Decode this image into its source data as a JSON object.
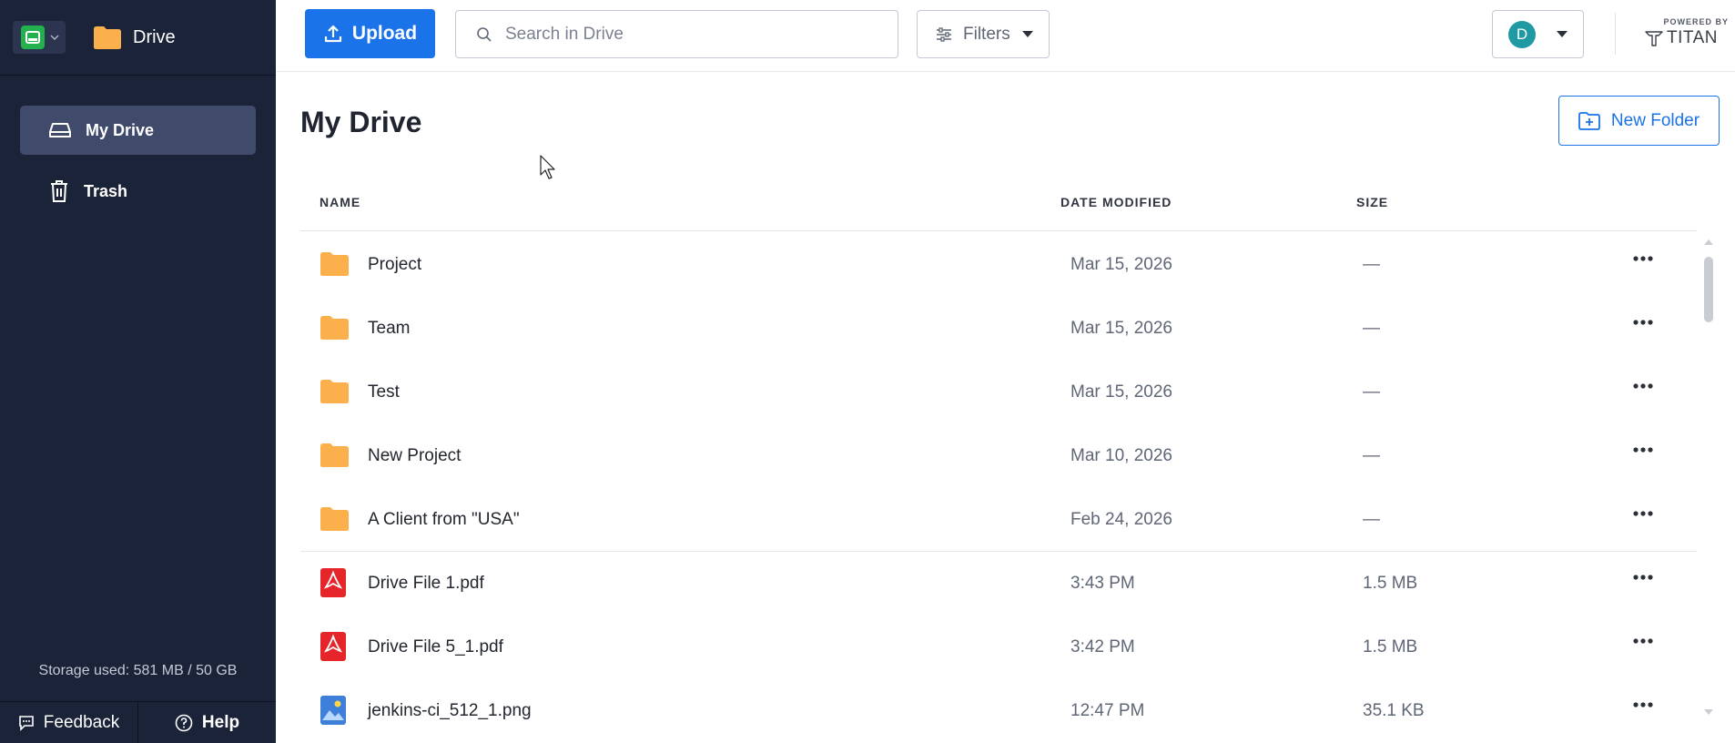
{
  "sidebar": {
    "brand": "Drive",
    "nav": [
      {
        "label": "My Drive",
        "icon": "drive-icon",
        "active": true
      },
      {
        "label": "Trash",
        "icon": "trash-icon",
        "active": false
      }
    ],
    "storage": "Storage used: 581 MB / 50 GB",
    "feedback": "Feedback",
    "help": "Help"
  },
  "toolbar": {
    "upload_label": "Upload",
    "search_placeholder": "Search in Drive",
    "filters_label": "Filters",
    "avatar_initial": "D",
    "powered_by": "POWERED BY",
    "titan": "TITAN"
  },
  "main": {
    "title": "My Drive",
    "new_folder_label": "New Folder",
    "columns": {
      "name": "NAME",
      "date": "DATE MODIFIED",
      "size": "SIZE"
    },
    "rows": [
      {
        "type": "folder",
        "name": "Project",
        "date": "Mar 15, 2026",
        "size": "—"
      },
      {
        "type": "folder",
        "name": "Team",
        "date": "Mar 15, 2026",
        "size": "—"
      },
      {
        "type": "folder",
        "name": "Test",
        "date": "Mar 15, 2026",
        "size": "—"
      },
      {
        "type": "folder",
        "name": "New Project",
        "date": "Mar 10, 2026",
        "size": "—"
      },
      {
        "type": "folder",
        "name": "A Client from \"USA\"",
        "date": "Feb 24, 2026",
        "size": "—"
      },
      {
        "type": "pdf",
        "name": "Drive File 1.pdf",
        "date": "3:43 PM",
        "size": "1.5 MB"
      },
      {
        "type": "pdf",
        "name": "Drive File 5_1.pdf",
        "date": "3:42 PM",
        "size": "1.5 MB"
      },
      {
        "type": "image",
        "name": "jenkins-ci_512_1.png",
        "date": "12:47 PM",
        "size": "35.1 KB"
      }
    ]
  },
  "colors": {
    "sidebar_bg": "#1b2338",
    "accent": "#1a73e8",
    "folder": "#fbb04c",
    "pdf": "#e5252a",
    "avatar": "#1f9aa3"
  }
}
